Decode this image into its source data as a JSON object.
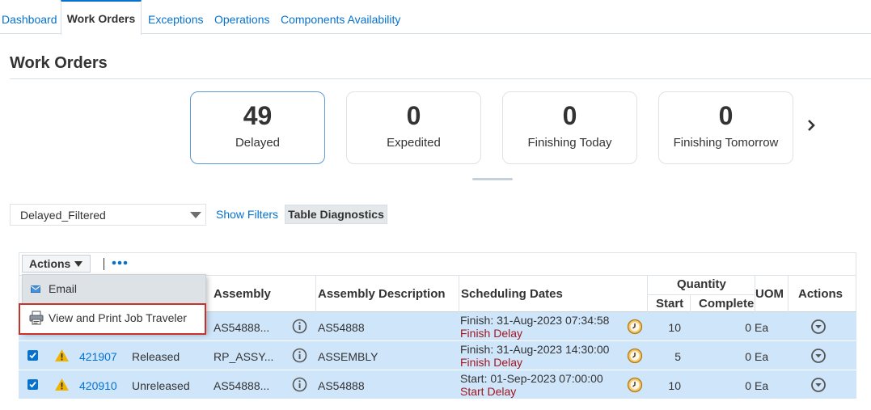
{
  "tabs": [
    {
      "label": "Dashboard"
    },
    {
      "label": "Work Orders",
      "active": true
    },
    {
      "label": "Exceptions"
    },
    {
      "label": "Operations"
    },
    {
      "label": "Components Availability"
    }
  ],
  "page_title": "Work Orders",
  "tiles": [
    {
      "count": "49",
      "label": "Delayed",
      "selected": true
    },
    {
      "count": "0",
      "label": "Expedited"
    },
    {
      "count": "0",
      "label": "Finishing Today"
    },
    {
      "count": "0",
      "label": "Finishing Tomorrow"
    }
  ],
  "filters": {
    "saved_search_value": "Delayed_Filtered",
    "show_filters_label": "Show Filters",
    "table_diagnostics_label": "Table Diagnostics"
  },
  "toolbar": {
    "actions_label": "Actions"
  },
  "menu": {
    "items": [
      {
        "label": "Email",
        "icon": "mail-icon"
      },
      {
        "label": "View and Print Job Traveler",
        "icon": "printer-icon"
      }
    ]
  },
  "table": {
    "columns": {
      "assembly": "Assembly",
      "assembly_description": "Assembly Description",
      "scheduling_dates": "Scheduling Dates",
      "quantity": "Quantity",
      "start": "Start",
      "complete": "Complete",
      "uom": "UOM",
      "actions": "Actions"
    },
    "rows": [
      {
        "work_order": "",
        "status": "",
        "assembly": "AS54888...",
        "description": "AS54888",
        "date_line": "Finish: 31-Aug-2023 07:34:58",
        "date_status": "Finish Delay",
        "start_qty": "10",
        "complete_qty": "0",
        "uom": "Ea"
      },
      {
        "work_order": "421907",
        "status": "Released",
        "assembly": "RP_ASSY...",
        "description": "ASSEMBLY",
        "date_line": "Finish: 31-Aug-2023 14:30:00",
        "date_status": "Finish Delay",
        "start_qty": "5",
        "complete_qty": "0",
        "uom": "Ea"
      },
      {
        "work_order": "420910",
        "status": "Unreleased",
        "assembly": "AS54888...",
        "description": "AS54888",
        "date_line": "Start: 01-Sep-2023 07:00:00",
        "date_status": "Start Delay",
        "start_qty": "10",
        "complete_qty": "0",
        "uom": "Ea"
      }
    ]
  },
  "colors": {
    "accent": "#0572ce",
    "row_selected": "#cfe5fa",
    "delay_text": "#a1171e",
    "warning": "#f0b400",
    "highlight_border": "#c8322a"
  }
}
